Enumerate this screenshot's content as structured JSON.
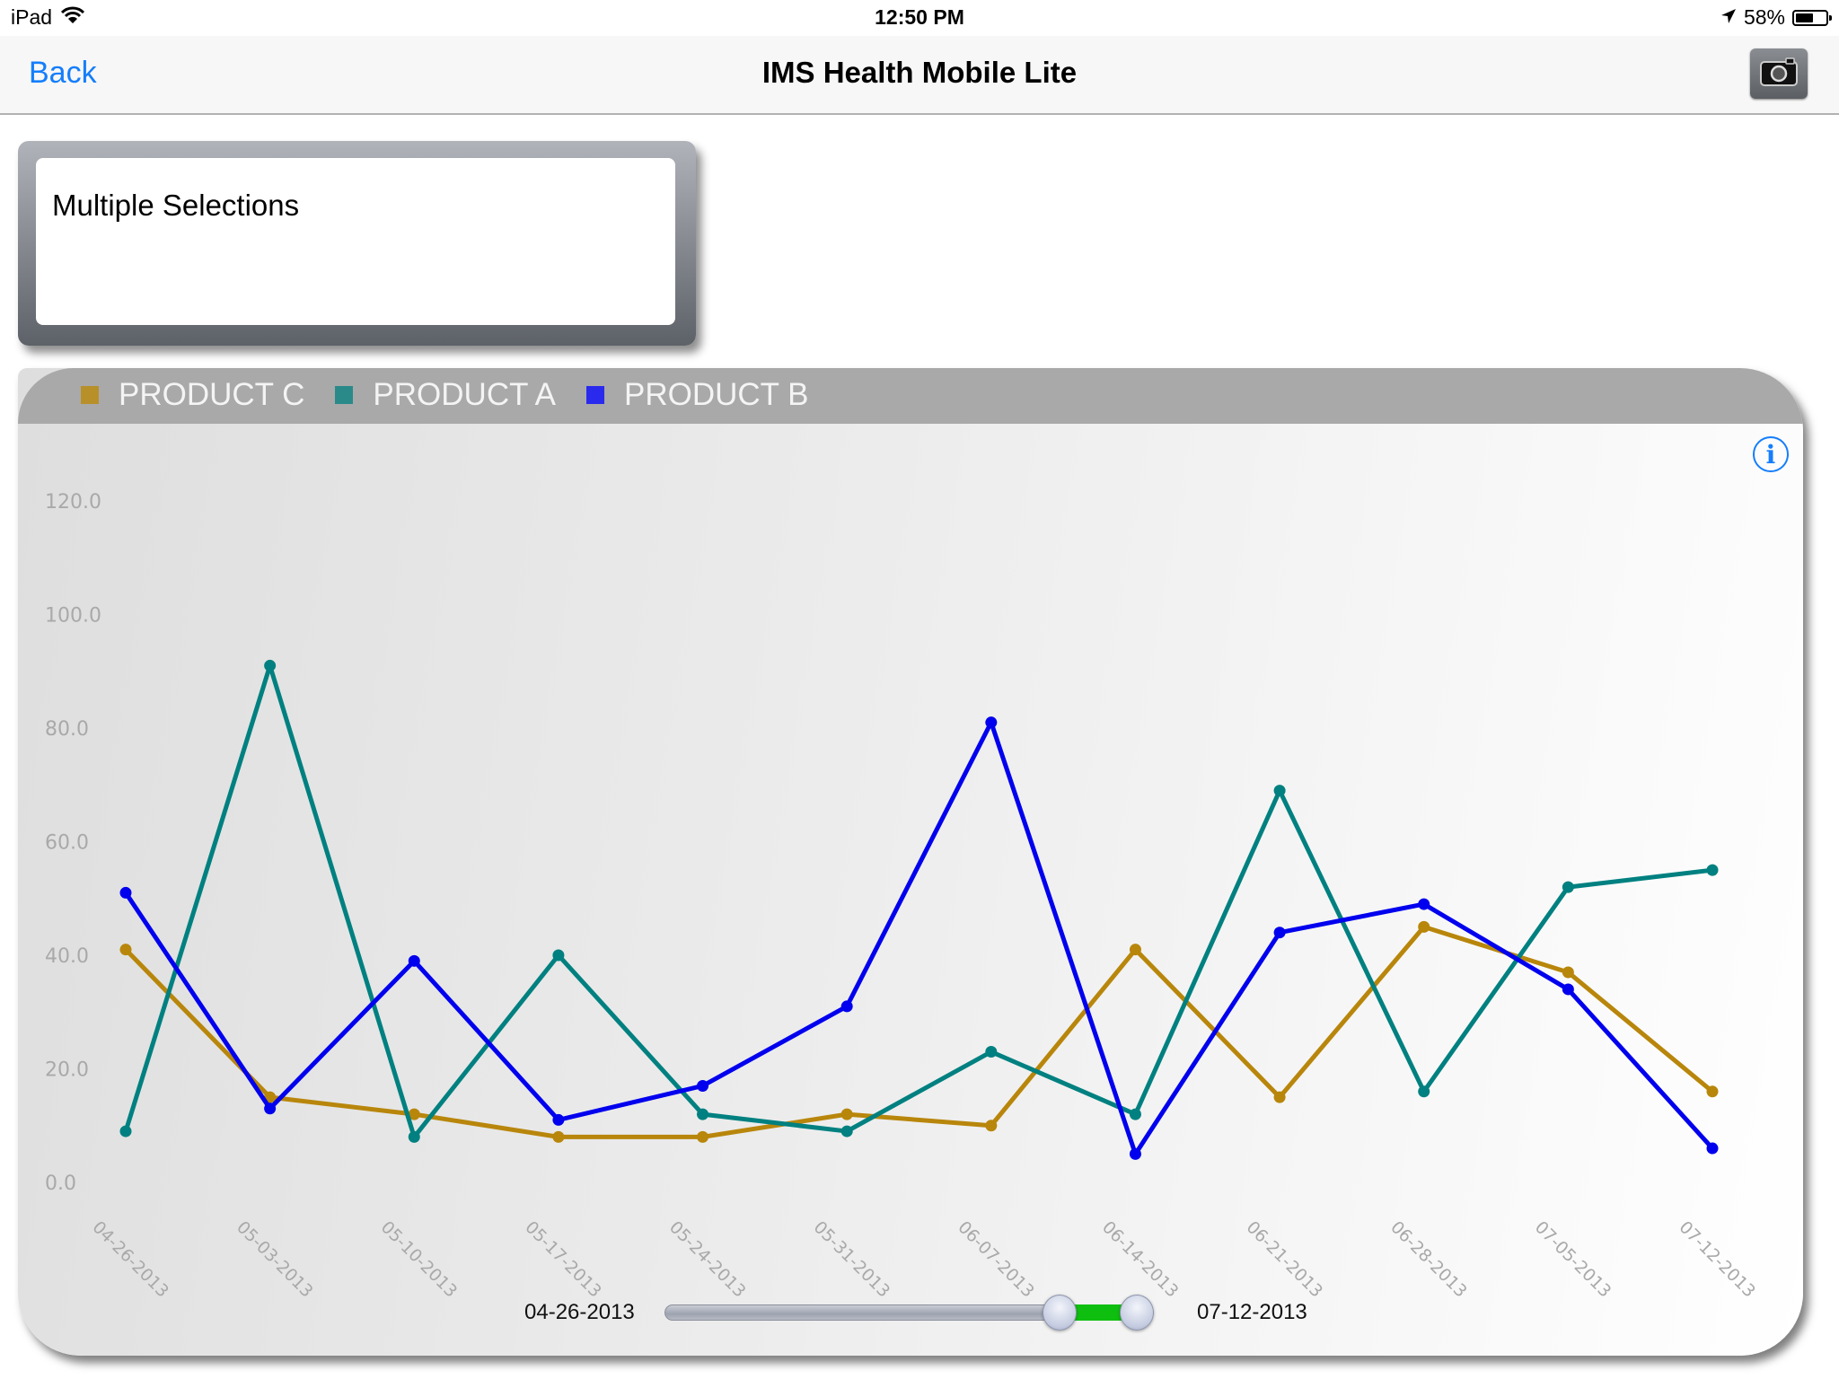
{
  "status_bar": {
    "device": "iPad",
    "time": "12:50 PM",
    "battery_percent_label": "58%",
    "battery_level": 0.58,
    "icons": [
      "wifi-icon",
      "location-arrow-icon",
      "battery-icon"
    ]
  },
  "nav": {
    "back_label": "Back",
    "title": "IMS Health Mobile Lite",
    "camera_icon": "camera-icon"
  },
  "selection": {
    "text": "Multiple Selections"
  },
  "chart_data": {
    "type": "line",
    "title": "",
    "xlabel": "",
    "ylabel": "",
    "ylim": [
      0,
      120
    ],
    "y_ticks": [
      "0.0",
      "20.0",
      "40.0",
      "60.0",
      "80.0",
      "100.0",
      "120.0"
    ],
    "y_tick_values": [
      0,
      20,
      40,
      60,
      80,
      100,
      120
    ],
    "grid": false,
    "legend_position": "top-left",
    "categories": [
      "04-26-2013",
      "05-03-2013",
      "05-10-2013",
      "05-17-2013",
      "05-24-2013",
      "05-31-2013",
      "06-07-2013",
      "06-14-2013",
      "06-21-2013",
      "06-28-2013",
      "07-05-2013",
      "07-12-2013"
    ],
    "series": [
      {
        "name": "PRODUCT C",
        "color": "#b8860b",
        "values": [
          41,
          15,
          12,
          8,
          8,
          12,
          10,
          41,
          15,
          45,
          37,
          16
        ]
      },
      {
        "name": "PRODUCT A",
        "color": "#008080",
        "values": [
          9,
          91,
          8,
          40,
          12,
          9,
          23,
          12,
          69,
          16,
          52,
          55
        ]
      },
      {
        "name": "PRODUCT B",
        "color": "#0000ee",
        "values": [
          51,
          13,
          39,
          11,
          17,
          31,
          81,
          5,
          44,
          49,
          34,
          6
        ]
      }
    ]
  },
  "legend_colors": {
    "PRODUCT C": "#b8902a",
    "PRODUCT A": "#2a8a8a",
    "PRODUCT B": "#2a2aee"
  },
  "info_label": "i",
  "date_range": {
    "start_label": "04-26-2013",
    "end_label": "07-12-2013",
    "range_fill_color": "#0fbf0f",
    "lower_thumb_fraction": 0.83,
    "upper_thumb_fraction": 1.0
  }
}
